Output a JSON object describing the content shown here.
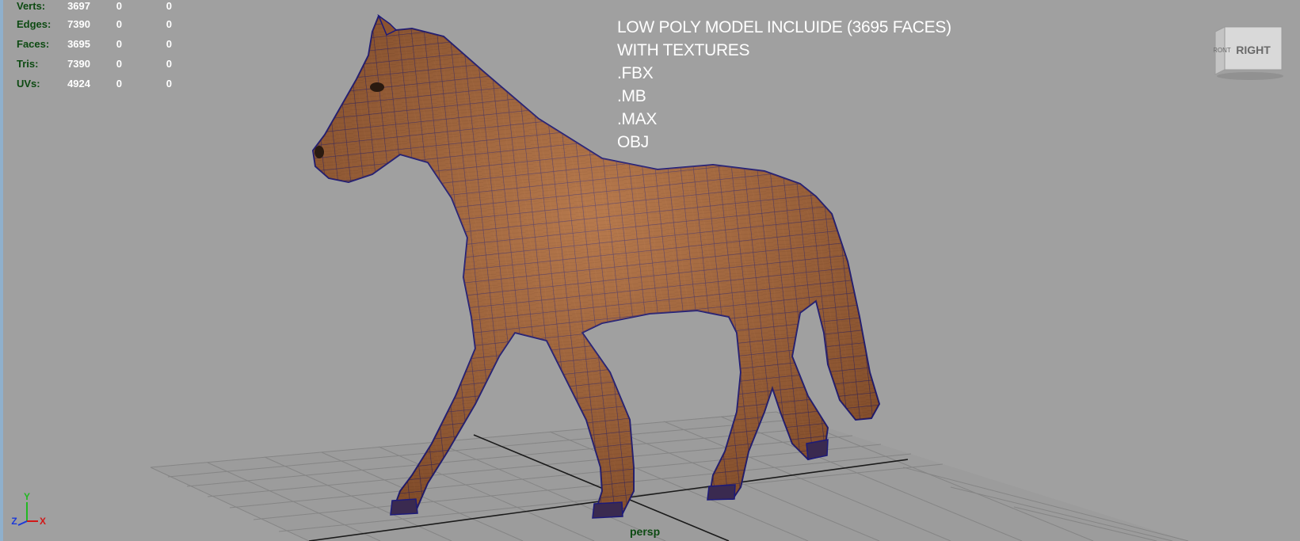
{
  "stats": {
    "rows": [
      {
        "label": "Verts:",
        "v1": "3697",
        "v2": "0",
        "v3": "0"
      },
      {
        "label": "Edges:",
        "v1": "7390",
        "v2": "0",
        "v3": "0"
      },
      {
        "label": "Faces:",
        "v1": "3695",
        "v2": "0",
        "v3": "0"
      },
      {
        "label": "Tris:",
        "v1": "7390",
        "v2": "0",
        "v3": "0"
      },
      {
        "label": "UVs:",
        "v1": "4924",
        "v2": "0",
        "v3": "0"
      }
    ]
  },
  "overlay": {
    "lines": [
      "LOW POLY MODEL INCLUIDE (3695 FACES)",
      "WITH TEXTURES",
      ".FBX",
      ".MB",
      ".MAX",
      "OBJ"
    ]
  },
  "view_cube": {
    "front": "FRONT",
    "right": "RIGHT"
  },
  "camera": {
    "name": "persp"
  },
  "axes": {
    "x": "X",
    "y": "Y",
    "z": "Z"
  },
  "colors": {
    "background": "#a0a0a0",
    "hud_label": "#0d4a12",
    "wire": "#1c1a7a",
    "skin": "#a8673c",
    "axis_x": "#d11818",
    "axis_y": "#22b822",
    "axis_z": "#1c3ad8"
  }
}
